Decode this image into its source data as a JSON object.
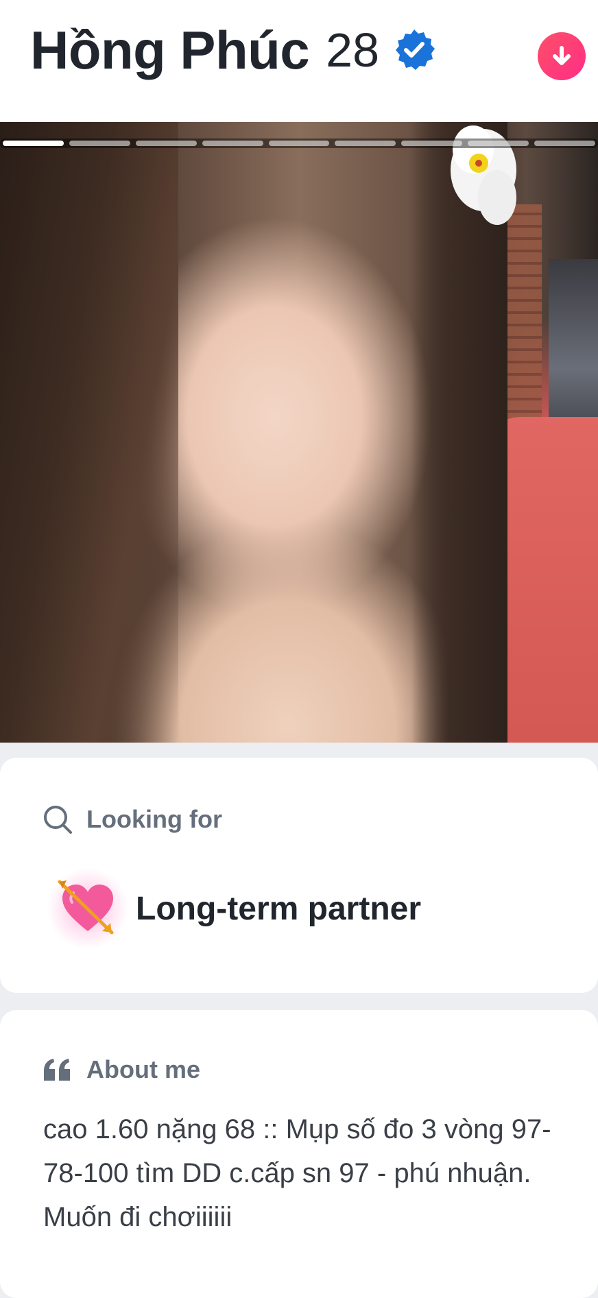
{
  "profile": {
    "name": "Hồng Phúc",
    "age": "28",
    "verified_icon": "verified-badge-icon",
    "download_icon": "arrow-down-icon"
  },
  "photo": {
    "total_photos": 9,
    "active_photo": 1
  },
  "looking_for": {
    "heading": "Looking for",
    "heading_icon": "search-icon",
    "value": "Long-term partner",
    "value_icon": "heart-with-arrow-icon"
  },
  "about_me": {
    "heading": "About me",
    "heading_icon": "quote-icon",
    "text": "cao 1.60 nặng 68 :: Mụp số đo 3 vòng 97-78-100 tìm DD c.cấp sn 97 - phú nhuận. Muốn đi chơiiiiii"
  },
  "colors": {
    "brand_gradient_start": "#fd5068",
    "brand_gradient_end": "#ff2d88",
    "verified_blue": "#1a73d9",
    "title_text": "#21262e",
    "section_label": "#656e7b"
  }
}
